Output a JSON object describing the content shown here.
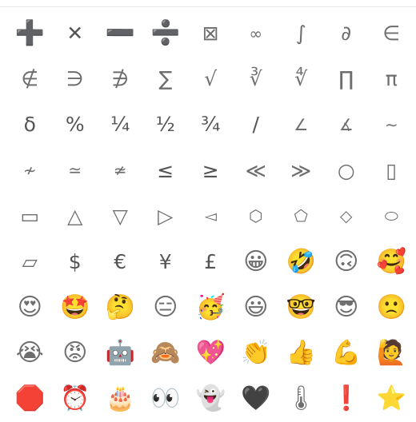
{
  "symbols": {
    "rows": [
      [
        {
          "char": "➕",
          "name": "heavy-plus-symbol",
          "kind": "heavy"
        },
        {
          "char": "✕",
          "name": "multiply-symbol",
          "kind": "mid"
        },
        {
          "char": "➖",
          "name": "heavy-minus-symbol",
          "kind": "heavy"
        },
        {
          "char": "➗",
          "name": "heavy-divide-symbol",
          "kind": "heavy"
        },
        {
          "char": "⊠",
          "name": "missing-glyph-box-icon",
          "kind": "plain"
        },
        {
          "char": "∞",
          "name": "infinity-symbol",
          "kind": "small"
        },
        {
          "char": "∫",
          "name": "integral-symbol",
          "kind": "plain"
        },
        {
          "char": "∂",
          "name": "partial-differential-symbol",
          "kind": "plain"
        },
        {
          "char": "∈",
          "name": "element-of-symbol",
          "kind": "plain"
        }
      ],
      [
        {
          "char": "∉",
          "name": "not-element-of-symbol",
          "kind": "plain"
        },
        {
          "char": "∋",
          "name": "contains-as-member-symbol",
          "kind": "plain"
        },
        {
          "char": "∌",
          "name": "does-not-contain-symbol",
          "kind": "plain"
        },
        {
          "char": "∑",
          "name": "n-ary-summation-symbol",
          "kind": "plain"
        },
        {
          "char": "√",
          "name": "square-root-symbol",
          "kind": "plain"
        },
        {
          "char": "∛",
          "name": "cube-root-symbol",
          "kind": "plain"
        },
        {
          "char": "∜",
          "name": "fourth-root-symbol",
          "kind": "plain"
        },
        {
          "char": "∏",
          "name": "n-ary-product-symbol",
          "kind": "plain"
        },
        {
          "char": "π",
          "name": "pi-symbol",
          "kind": "plain"
        }
      ],
      [
        {
          "char": "δ",
          "name": "delta-symbol",
          "kind": "mid"
        },
        {
          "char": "%",
          "name": "percent-symbol",
          "kind": "mid"
        },
        {
          "char": "¼",
          "name": "one-quarter-symbol",
          "kind": "mid"
        },
        {
          "char": "½",
          "name": "one-half-symbol",
          "kind": "mid"
        },
        {
          "char": "¾",
          "name": "three-quarters-symbol",
          "kind": "mid"
        },
        {
          "char": "/",
          "name": "slash-symbol",
          "kind": "mid"
        },
        {
          "char": "∠",
          "name": "angle-symbol",
          "kind": "small"
        },
        {
          "char": "∡",
          "name": "measured-angle-symbol",
          "kind": "small"
        },
        {
          "char": "∼",
          "name": "tilde-operator-symbol",
          "kind": "small"
        }
      ],
      [
        {
          "char": "≁",
          "name": "not-tilde-symbol",
          "kind": "small"
        },
        {
          "char": "≃",
          "name": "asymptotically-equal-symbol",
          "kind": "small"
        },
        {
          "char": "≄",
          "name": "not-asymptotically-equal-symbol",
          "kind": "small"
        },
        {
          "char": "≤",
          "name": "less-than-or-equal-symbol",
          "kind": "mid"
        },
        {
          "char": "≥",
          "name": "greater-than-or-equal-symbol",
          "kind": "mid"
        },
        {
          "char": "≪",
          "name": "much-less-than-symbol",
          "kind": "plain"
        },
        {
          "char": "≫",
          "name": "much-greater-than-symbol",
          "kind": "plain"
        },
        {
          "char": "○",
          "name": "white-circle-symbol",
          "kind": "plain"
        },
        {
          "char": "▯",
          "name": "white-vertical-rectangle-symbol",
          "kind": "plain"
        }
      ],
      [
        {
          "char": "▭",
          "name": "white-rectangle-symbol",
          "kind": "plain"
        },
        {
          "char": "△",
          "name": "white-up-triangle-symbol",
          "kind": "plain"
        },
        {
          "char": "▽",
          "name": "white-down-triangle-symbol",
          "kind": "plain"
        },
        {
          "char": "▷",
          "name": "white-right-triangle-symbol",
          "kind": "plain"
        },
        {
          "char": "◅",
          "name": "white-left-pointer-symbol",
          "kind": "small"
        },
        {
          "char": "⬡",
          "name": "white-hexagon-symbol",
          "kind": "small"
        },
        {
          "char": "⬠",
          "name": "white-pentagon-symbol",
          "kind": "small"
        },
        {
          "char": "◇",
          "name": "white-diamond-symbol",
          "kind": "small"
        },
        {
          "char": "⬭",
          "name": "white-ellipse-symbol",
          "kind": "small"
        }
      ],
      [
        {
          "char": "▱",
          "name": "white-parallelogram-symbol",
          "kind": "plain"
        },
        {
          "char": "$",
          "name": "dollar-sign-symbol",
          "kind": "mid"
        },
        {
          "char": "€",
          "name": "euro-sign-symbol",
          "kind": "mid"
        },
        {
          "char": "¥",
          "name": "yen-sign-symbol",
          "kind": "mid"
        },
        {
          "char": "£",
          "name": "pound-sign-symbol",
          "kind": "mid"
        },
        {
          "char": "😀",
          "name": "grinning-face-emoji",
          "kind": "emoji"
        },
        {
          "char": "🤣",
          "name": "rolling-on-floor-laughing-emoji",
          "kind": "emoji"
        },
        {
          "char": "🙃",
          "name": "upside-down-face-emoji",
          "kind": "emoji"
        },
        {
          "char": "🥰",
          "name": "smiling-face-with-hearts-emoji",
          "kind": "emoji"
        }
      ],
      [
        {
          "char": "😍",
          "name": "heart-eyes-emoji",
          "kind": "emoji"
        },
        {
          "char": "🤩",
          "name": "star-struck-emoji",
          "kind": "emoji"
        },
        {
          "char": "🤔",
          "name": "thinking-face-emoji",
          "kind": "emoji"
        },
        {
          "char": "😑",
          "name": "expressionless-face-emoji",
          "kind": "emoji"
        },
        {
          "char": "🥳",
          "name": "partying-face-emoji",
          "kind": "emoji"
        },
        {
          "char": "😃",
          "name": "grinning-face-big-eyes-emoji",
          "kind": "emoji"
        },
        {
          "char": "🤓",
          "name": "nerd-face-emoji",
          "kind": "emoji"
        },
        {
          "char": "😎",
          "name": "sunglasses-face-emoji",
          "kind": "emoji"
        },
        {
          "char": "🙁",
          "name": "slightly-frowning-face-emoji",
          "kind": "emoji"
        }
      ],
      [
        {
          "char": "😭",
          "name": "loudly-crying-face-emoji",
          "kind": "emoji"
        },
        {
          "char": "😡",
          "name": "pouting-face-emoji",
          "kind": "emoji"
        },
        {
          "char": "🤖",
          "name": "robot-emoji",
          "kind": "emoji"
        },
        {
          "char": "🙈",
          "name": "see-no-evil-monkey-emoji",
          "kind": "emoji"
        },
        {
          "char": "💖",
          "name": "sparkling-heart-emoji",
          "kind": "emoji"
        },
        {
          "char": "👏",
          "name": "clapping-hands-emoji",
          "kind": "emoji"
        },
        {
          "char": "👍",
          "name": "thumbs-up-emoji",
          "kind": "emoji"
        },
        {
          "char": "💪",
          "name": "flexed-biceps-emoji",
          "kind": "emoji"
        },
        {
          "char": "🙋",
          "name": "person-raising-hand-emoji",
          "kind": "emoji"
        }
      ],
      [
        {
          "char": "🛑",
          "name": "stop-sign-emoji",
          "kind": "emoji"
        },
        {
          "char": "⏰",
          "name": "alarm-clock-emoji",
          "kind": "emoji"
        },
        {
          "char": "🎂",
          "name": "birthday-cake-emoji",
          "kind": "emoji"
        },
        {
          "char": "👀",
          "name": "eyes-emoji",
          "kind": "emoji"
        },
        {
          "char": "👻",
          "name": "ghost-emoji",
          "kind": "emoji"
        },
        {
          "char": "🖤",
          "name": "black-heart-emoji",
          "kind": "emoji"
        },
        {
          "char": "🌡",
          "name": "thermometer-emoji",
          "kind": "emoji"
        },
        {
          "char": "❗",
          "name": "exclamation-mark-emoji",
          "kind": "emoji"
        },
        {
          "char": "⭐",
          "name": "star-emoji",
          "kind": "emoji"
        }
      ]
    ]
  }
}
